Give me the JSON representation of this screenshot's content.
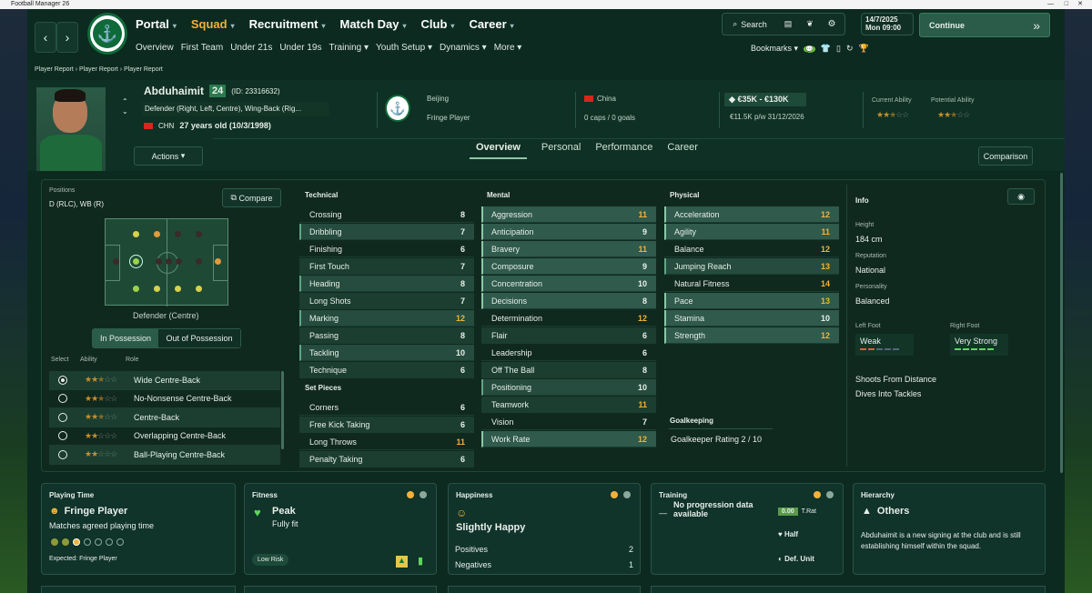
{
  "window": {
    "title": "Football Manager 26"
  },
  "nav": {
    "menus": [
      {
        "label": "Portal"
      },
      {
        "label": "Squad"
      },
      {
        "label": "Recruitment"
      },
      {
        "label": "Match Day"
      },
      {
        "label": "Club"
      },
      {
        "label": "Career"
      }
    ],
    "submenus": [
      "Overview",
      "First Team",
      "Under 21s",
      "Under 19s",
      "Training",
      "Youth Setup",
      "Dynamics",
      "More"
    ],
    "search": "Search",
    "date": "14/7/2025",
    "day": "Mon",
    "time": "09:00",
    "continue": "Continue",
    "bookmarks": "Bookmarks"
  },
  "breadcrumb": [
    "Player Report",
    "Player Report",
    "Player Report"
  ],
  "player": {
    "name": "Abduhaimit",
    "squad_no": "24",
    "id_text": "(ID: 23316632)",
    "positions": "Defender (Right, Left, Centre), Wing-Back (Rig...",
    "nation_code": "CHN",
    "age_text": "27 years old (10/3/1998)",
    "club_city": "Beijing",
    "squad_status": "Fringe Player",
    "nation": "China",
    "caps": "0 caps / 0 goals",
    "value": "€35K - €130K",
    "wage": "€11.5K p/w 31/12/2026",
    "ca_label": "Current Ability",
    "pa_label": "Potential Ability",
    "actions": "Actions",
    "comparison": "Comparison"
  },
  "tabs": [
    "Overview",
    "Personal",
    "Performance",
    "Career"
  ],
  "positions": {
    "label": "Positions",
    "value": "D (RLC), WB (R)",
    "compare": "Compare",
    "selected_pos": "Defender (Centre)",
    "in_pos": "In Possession",
    "out_pos": "Out of Possession",
    "col_select": "Select",
    "col_ability": "Ability",
    "col_role": "Role",
    "roles": [
      {
        "name": "Wide Centre-Back",
        "stars": 2.5
      },
      {
        "name": "No-Nonsense Centre-Back",
        "stars": 2.5
      },
      {
        "name": "Centre-Back",
        "stars": 2.5
      },
      {
        "name": "Overlapping Centre-Back",
        "stars": 2
      },
      {
        "name": "Ball-Playing Centre-Back",
        "stars": 2
      }
    ]
  },
  "technical": {
    "title": "Technical",
    "items": [
      {
        "n": "Crossing",
        "v": "8"
      },
      {
        "n": "Dribbling",
        "v": "7"
      },
      {
        "n": "Finishing",
        "v": "6"
      },
      {
        "n": "First Touch",
        "v": "7"
      },
      {
        "n": "Heading",
        "v": "8"
      },
      {
        "n": "Long Shots",
        "v": "7"
      },
      {
        "n": "Marking",
        "v": "12"
      },
      {
        "n": "Passing",
        "v": "8"
      },
      {
        "n": "Tackling",
        "v": "10"
      },
      {
        "n": "Technique",
        "v": "6"
      }
    ]
  },
  "setpieces": {
    "title": "Set Pieces",
    "items": [
      {
        "n": "Corners",
        "v": "6"
      },
      {
        "n": "Free Kick Taking",
        "v": "6"
      },
      {
        "n": "Long Throws",
        "v": "11"
      },
      {
        "n": "Penalty Taking",
        "v": "6"
      }
    ]
  },
  "mental": {
    "title": "Mental",
    "items": [
      {
        "n": "Aggression",
        "v": "11"
      },
      {
        "n": "Anticipation",
        "v": "9"
      },
      {
        "n": "Bravery",
        "v": "11"
      },
      {
        "n": "Composure",
        "v": "9"
      },
      {
        "n": "Concentration",
        "v": "10"
      },
      {
        "n": "Decisions",
        "v": "8"
      },
      {
        "n": "Determination",
        "v": "12"
      },
      {
        "n": "Flair",
        "v": "6"
      },
      {
        "n": "Leadership",
        "v": "6"
      },
      {
        "n": "Off The Ball",
        "v": "8"
      },
      {
        "n": "Positioning",
        "v": "10"
      },
      {
        "n": "Teamwork",
        "v": "11"
      },
      {
        "n": "Vision",
        "v": "7"
      },
      {
        "n": "Work Rate",
        "v": "12"
      }
    ]
  },
  "physical": {
    "title": "Physical",
    "items": [
      {
        "n": "Acceleration",
        "v": "12"
      },
      {
        "n": "Agility",
        "v": "11"
      },
      {
        "n": "Balance",
        "v": "12"
      },
      {
        "n": "Jumping Reach",
        "v": "13"
      },
      {
        "n": "Natural Fitness",
        "v": "14"
      },
      {
        "n": "Pace",
        "v": "13"
      },
      {
        "n": "Stamina",
        "v": "10"
      },
      {
        "n": "Strength",
        "v": "12"
      }
    ]
  },
  "goalkeeping": {
    "title": "Goalkeeping",
    "rating": "Goalkeeper Rating 2 / 10"
  },
  "info": {
    "title": "Info",
    "height_label": "Height",
    "height": "184 cm",
    "rep_label": "Reputation",
    "rep": "National",
    "pers_label": "Personality",
    "pers": "Balanced",
    "lf_label": "Left Foot",
    "lf": "Weak",
    "rf_label": "Right Foot",
    "rf": "Very Strong",
    "traits": [
      "Shoots From Distance",
      "Dives Into Tackles"
    ]
  },
  "cards": {
    "playing": {
      "title": "Playing Time",
      "status": "Fringe Player",
      "agreed": "Matches agreed playing time",
      "expected": "Expected: Fringe Player"
    },
    "fitness": {
      "title": "Fitness",
      "status": "Peak",
      "sub": "Fully fit",
      "risk": "Low Risk"
    },
    "happiness": {
      "title": "Happiness",
      "status": "Slightly Happy",
      "pos_label": "Positives",
      "pos": "2",
      "neg_label": "Negatives",
      "neg": "1"
    },
    "training": {
      "title": "Training",
      "nodata": "No progression data available",
      "rating": "0.00",
      "rating_label": "T.Rat",
      "intensity": "Half",
      "unit": "Def. Unit"
    },
    "hierarchy": {
      "title": "Hierarchy",
      "status": "Others",
      "desc": "Abduhaimit is a new signing at the club and is still establishing himself within the squad."
    }
  },
  "colors": {
    "accent": "#f2b23a",
    "panel": "#10291f",
    "good": "#89c9a6"
  }
}
